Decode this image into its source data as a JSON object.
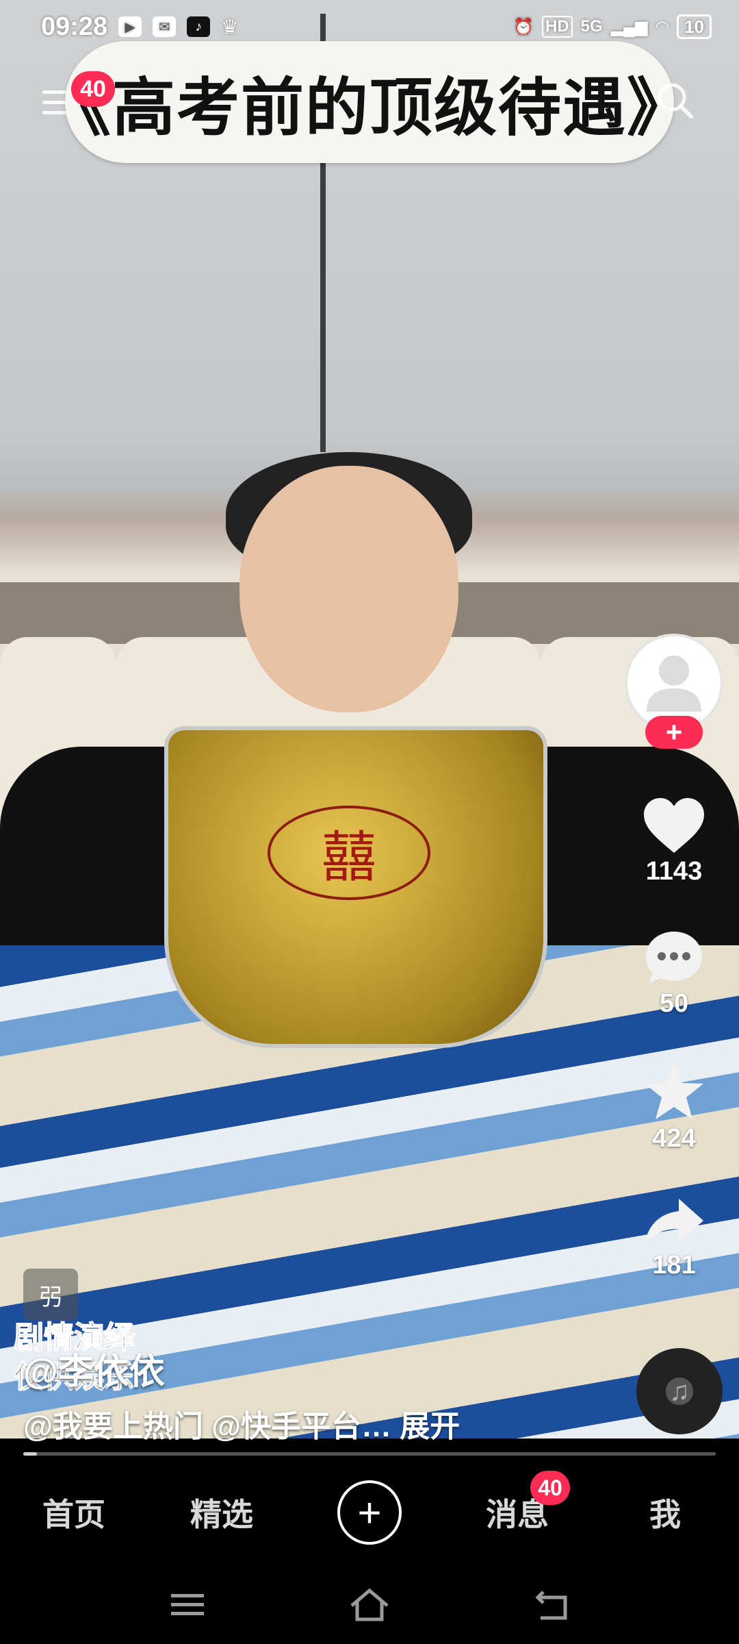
{
  "status_bar": {
    "time": "09:28",
    "network": "5G",
    "hd": "HD",
    "battery": "10"
  },
  "header": {
    "title": "《高考前的顶级待遇》",
    "notification_badge": "40"
  },
  "video_overlay": {
    "emblem_char": "囍",
    "tag": "弜",
    "disclaimer": "剧情演绎 仅供娱乐",
    "author": "@李依依",
    "caption": "@我要上热门 @快手平台… 展开",
    "progress": 0.02
  },
  "side_actions": {
    "likes": "1143",
    "comments": "50",
    "favorites": "424",
    "shares": "181",
    "follow_label": "+"
  },
  "bottom_nav": {
    "home": "首页",
    "featured": "精选",
    "create": "+",
    "messages": "消息",
    "messages_badge": "40",
    "me": "我"
  },
  "colors": {
    "accent": "#fe2c55",
    "background": "#000000"
  }
}
